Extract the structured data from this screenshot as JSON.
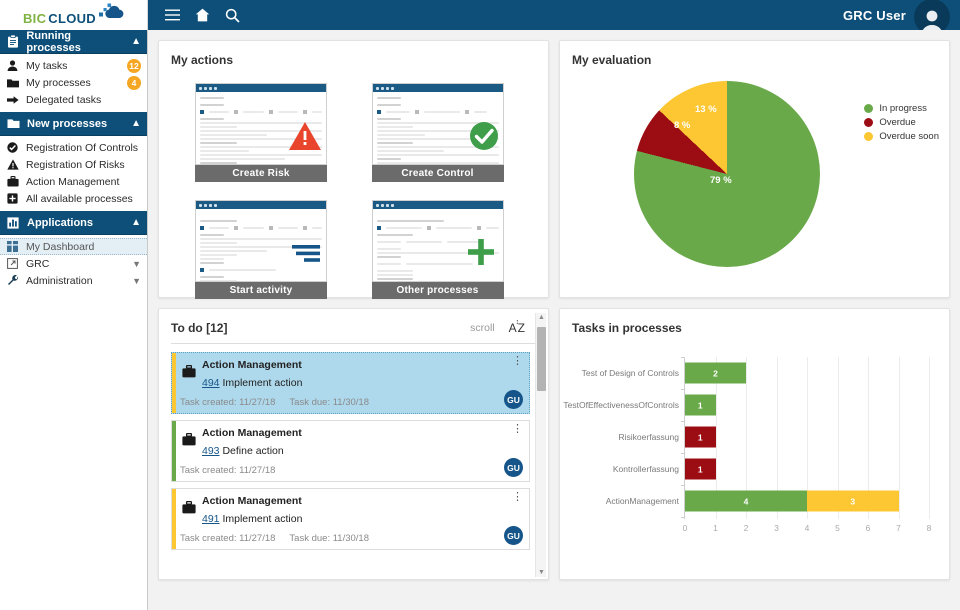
{
  "brand": {
    "bic": "BIC",
    "cloud": "CLOUD",
    "logo_icon": "cloud-icon"
  },
  "topbar": {
    "menu_icon": "hamburger-menu-icon",
    "home_icon": "home-icon",
    "search_icon": "search-icon",
    "user_name": "GRC User",
    "avatar_icon": "user-avatar-icon"
  },
  "sidebar": {
    "sections": [
      {
        "label": "Running processes",
        "icon": "clipboard-icon",
        "chevron": "chevron-up-icon",
        "items": [
          {
            "label": "My tasks",
            "icon": "person-icon",
            "badge": "12"
          },
          {
            "label": "My processes",
            "icon": "folder-icon",
            "badge": "4"
          },
          {
            "label": "Delegated tasks",
            "icon": "arrow-right-icon",
            "badge": ""
          }
        ]
      },
      {
        "label": "New processes",
        "icon": "folder-icon",
        "chevron": "chevron-up-icon",
        "items": [
          {
            "label": "Registration Of Controls",
            "icon": "check-circle-icon",
            "badge": ""
          },
          {
            "label": "Registration Of Risks",
            "icon": "warning-triangle-icon",
            "badge": ""
          },
          {
            "label": "Action Management",
            "icon": "briefcase-icon",
            "badge": ""
          },
          {
            "label": "All available processes",
            "icon": "plus-square-icon",
            "badge": ""
          }
        ]
      },
      {
        "label": "Applications",
        "icon": "bar-chart-icon",
        "chevron": "chevron-up-icon",
        "items": [
          {
            "label": "My Dashboard",
            "icon": "dashboard-grid-icon",
            "badge": "",
            "active": true
          },
          {
            "label": "GRC",
            "icon": "external-link-icon",
            "badge": "",
            "chevron": "chevron-down-icon"
          },
          {
            "label": "Administration",
            "icon": "wrench-icon",
            "badge": "",
            "chevron": "chevron-down-icon"
          }
        ]
      }
    ]
  },
  "my_actions": {
    "title": "My actions",
    "tiles": [
      {
        "label": "Create Risk",
        "overlay_icon": "warning-triangle-icon",
        "overlay_color": "#e8452c"
      },
      {
        "label": "Create Control",
        "overlay_icon": "check-circle-icon",
        "overlay_color": "#3e9e4a"
      },
      {
        "label": "Start activity",
        "overlay_icon": "bars-icon",
        "overlay_color": "#15558a"
      },
      {
        "label": "Other processes",
        "overlay_icon": "plus-icon",
        "overlay_color": "#3e9e4a"
      }
    ]
  },
  "my_evaluation": {
    "title": "My evaluation",
    "chart_data": {
      "type": "pie",
      "title": "My evaluation",
      "labels": [
        "In progress",
        "Overdue",
        "Overdue soon"
      ],
      "values": [
        79,
        8,
        13
      ],
      "value_labels": [
        "79 %",
        "8 %",
        "13 %"
      ],
      "colors": [
        "#6aa94a",
        "#9c0d13",
        "#fcc733"
      ],
      "legend_position": "right",
      "unit": "%"
    }
  },
  "todo": {
    "title": "To do [12]",
    "scroll_label": "scroll",
    "sort_label": "AZ",
    "sort_icon": "sort-arrow-icon",
    "kebab_icon": "more-vertical-icon",
    "created_prefix": "Task created:",
    "due_prefix": "Task due:",
    "tasks": [
      {
        "process": "Action Management",
        "number": "494",
        "activity": "Implement action",
        "created": "Task created: 11/27/18",
        "due": "Task due: 11/30/18",
        "avatar": "GU",
        "stripe": "#fcc733",
        "selected": true,
        "icon": "briefcase-icon"
      },
      {
        "process": "Action Management",
        "number": "493",
        "activity": "Define action",
        "created": "Task created: 11/27/18",
        "due": "",
        "avatar": "GU",
        "stripe": "#6aa94a",
        "selected": false,
        "icon": "briefcase-icon"
      },
      {
        "process": "Action Management",
        "number": "491",
        "activity": "Implement action",
        "created": "Task created: 11/27/18",
        "due": "Task due: 11/30/18",
        "avatar": "GU",
        "stripe": "#fcc733",
        "selected": false,
        "icon": "briefcase-icon"
      }
    ],
    "partial_task_stripe": "#6aa94a",
    "scroll_up_icon": "caret-up-icon",
    "scroll_down_icon": "caret-down-icon"
  },
  "tasks_in_processes": {
    "title": "Tasks in processes",
    "chart_data": {
      "type": "bar",
      "orientation": "horizontal",
      "stacked": true,
      "title": "Tasks in processes",
      "categories": [
        "Test of Design of Controls",
        "TestOfEffectivenessOfControls",
        "Risikoerfassung",
        "Kontrollerfassung",
        "ActionManagement"
      ],
      "series": [
        {
          "name": "In progress",
          "color": "#6aa94a",
          "values": [
            2,
            1,
            0,
            0,
            4
          ]
        },
        {
          "name": "Overdue",
          "color": "#9c0d13",
          "values": [
            0,
            0,
            1,
            1,
            0
          ]
        },
        {
          "name": "Overdue soon",
          "color": "#fcc733",
          "values": [
            0,
            0,
            0,
            0,
            3
          ]
        }
      ],
      "bar_labels": [
        [
          "2"
        ],
        [
          "1"
        ],
        [
          "1"
        ],
        [
          "1"
        ],
        [
          "4",
          "3"
        ]
      ],
      "xlim": [
        0,
        8
      ],
      "xticks": [
        "0",
        "1",
        "2",
        "3",
        "4",
        "5",
        "6",
        "7",
        "8"
      ],
      "xlabel": "",
      "ylabel": "",
      "grid": true,
      "legend_position": "none"
    }
  }
}
